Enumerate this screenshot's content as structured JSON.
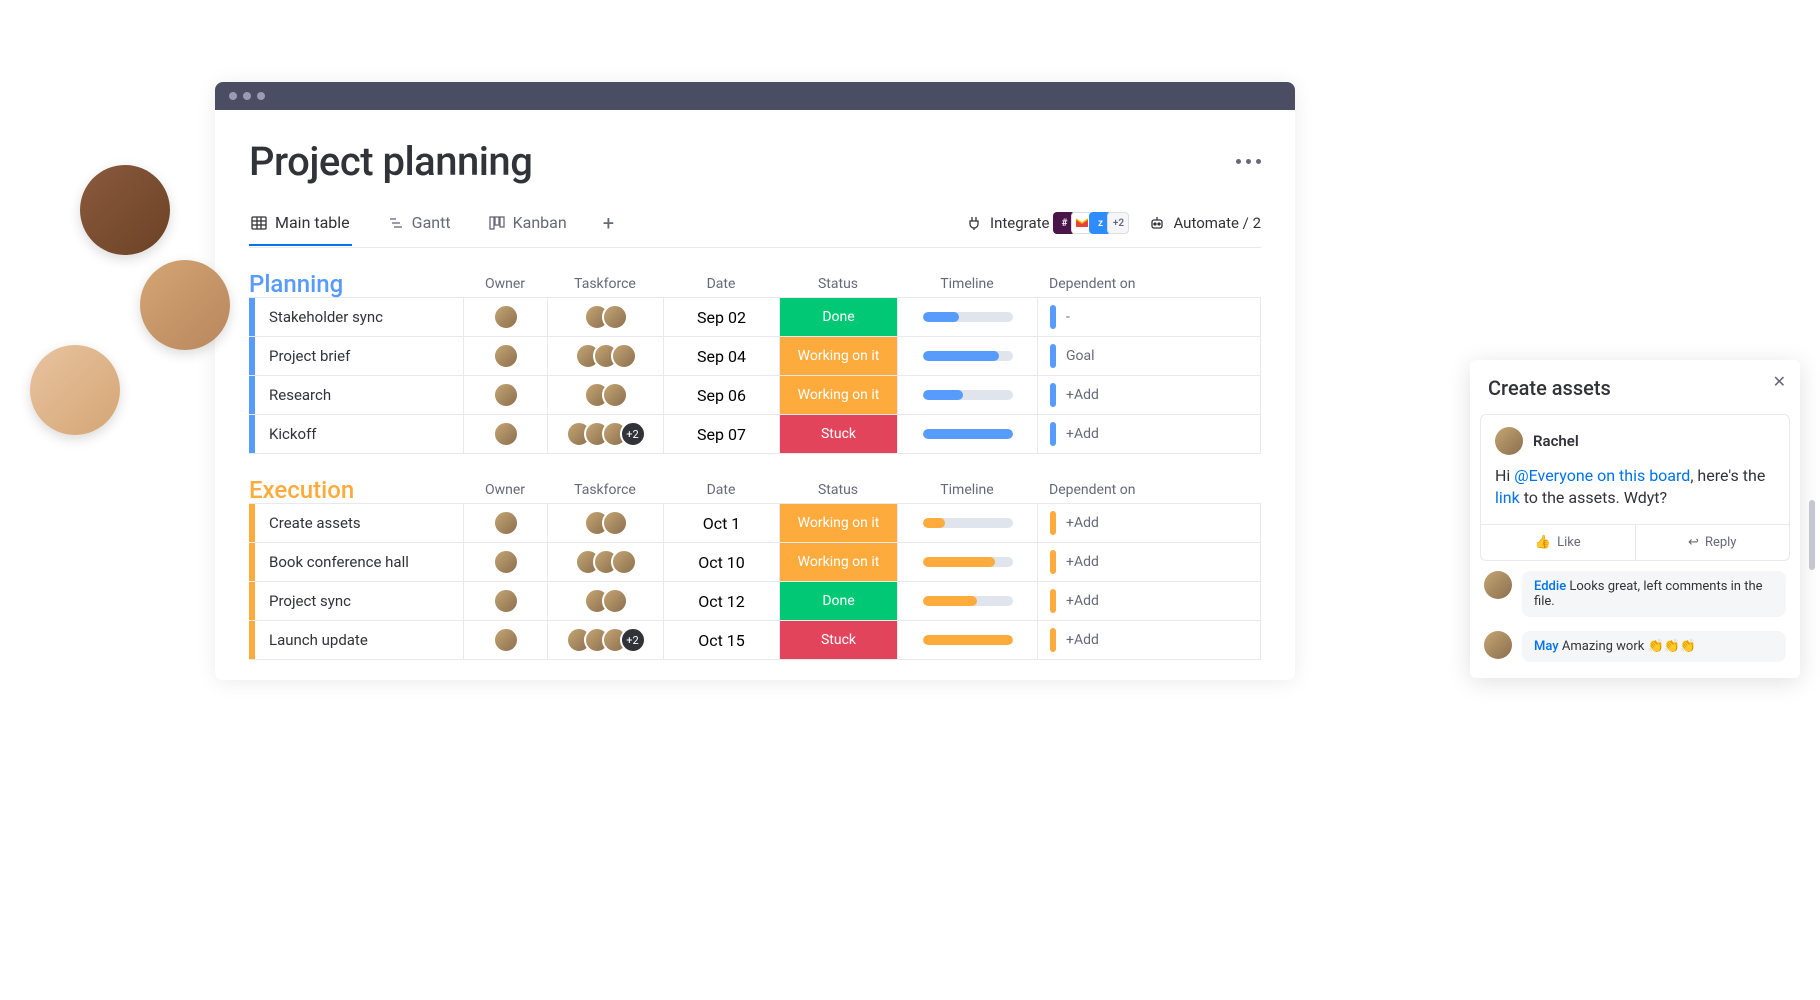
{
  "page_title": "Project planning",
  "tabs": {
    "main": "Main table",
    "gantt": "Gantt",
    "kanban": "Kanban"
  },
  "toolbar": {
    "integrate": "Integrate",
    "integrate_more": "+2",
    "automate": "Automate / 2"
  },
  "columns": {
    "owner": "Owner",
    "taskforce": "Taskforce",
    "date": "Date",
    "status": "Status",
    "timeline": "Timeline",
    "dependent": "Dependent on"
  },
  "groups": {
    "planning": {
      "title": "Planning",
      "rows": [
        {
          "task": "Stakeholder sync",
          "date": "Sep 02",
          "status": "Done",
          "status_class": "done",
          "timeline_pct": 40,
          "taskforce_count": 2,
          "dependent": "-"
        },
        {
          "task": "Project brief",
          "date": "Sep 04",
          "status": "Working on it",
          "status_class": "working",
          "timeline_pct": 85,
          "taskforce_count": 3,
          "dependent": "Goal"
        },
        {
          "task": "Research",
          "date": "Sep 06",
          "status": "Working on it",
          "status_class": "working",
          "timeline_pct": 45,
          "taskforce_count": 2,
          "dependent": "+Add"
        },
        {
          "task": "Kickoff",
          "date": "Sep 07",
          "status": "Stuck",
          "status_class": "stuck",
          "timeline_pct": 100,
          "taskforce_count": 5,
          "tf_extra": "+2",
          "dependent": "+Add"
        }
      ]
    },
    "execution": {
      "title": "Execution",
      "rows": [
        {
          "task": "Create assets",
          "date": "Oct 1",
          "status": "Working on it",
          "status_class": "working",
          "timeline_pct": 25,
          "taskforce_count": 2,
          "dependent": "+Add"
        },
        {
          "task": "Book conference hall",
          "date": "Oct 10",
          "status": "Working on it",
          "status_class": "working",
          "timeline_pct": 80,
          "taskforce_count": 3,
          "dependent": "+Add"
        },
        {
          "task": "Project sync",
          "date": "Oct 12",
          "status": "Done",
          "status_class": "done",
          "timeline_pct": 60,
          "taskforce_count": 2,
          "dependent": "+Add"
        },
        {
          "task": "Launch update",
          "date": "Oct 15",
          "status": "Stuck",
          "status_class": "stuck",
          "timeline_pct": 100,
          "taskforce_count": 5,
          "tf_extra": "+2",
          "dependent": "+Add"
        }
      ]
    }
  },
  "panel": {
    "title": "Create assets",
    "author": "Rachel",
    "body_prefix": "Hi ",
    "mention": "@Everyone on this board",
    "body_mid": ", here's the ",
    "link_text": "link",
    "body_suffix": " to the assets. Wdyt?",
    "like": "Like",
    "reply": "Reply",
    "replies": [
      {
        "author": "Eddie",
        "text": " Looks great, left comments in the file."
      },
      {
        "author": "May",
        "text": " Amazing work 👏👏👏"
      }
    ]
  }
}
